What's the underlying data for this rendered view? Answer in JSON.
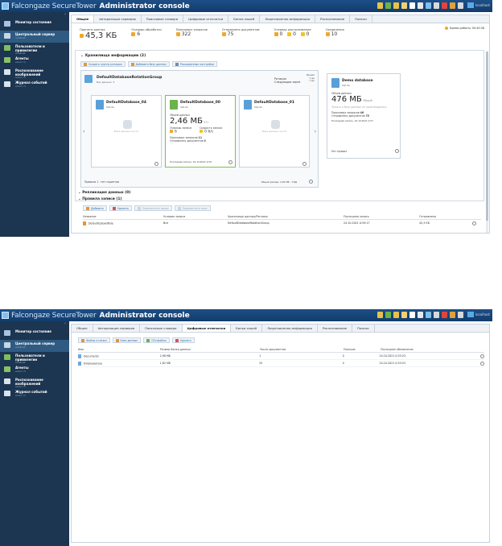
{
  "brand": "Falcongaze SecureTower",
  "title": "Administrator console",
  "host": "localhost",
  "sidebar": [
    {
      "label": "Монитор состояния",
      "sub": "",
      "color": "#aac4e0"
    },
    {
      "label": "Центральный сервер",
      "sub": "localhost",
      "color": "#c9d6e3"
    },
    {
      "label": "Пользователи и привилегии",
      "sub": "localhost",
      "color": "#7fbf5a"
    },
    {
      "label": "Агенты",
      "sub": "агент (?)",
      "color": "#8ac263"
    },
    {
      "label": "Распознавание изображений",
      "sub": "агент (?)",
      "color": "#d9e3ee"
    },
    {
      "label": "Журнал событий",
      "sub": "агент (?)",
      "color": "#d9e3ee"
    }
  ],
  "tabs1": [
    "Общее",
    "Авторизация серверов",
    "Поисковые словари",
    "Цифровые отпечатки",
    "Банки хэшей",
    "Лицензионная информация",
    "Распознавание",
    "Поиски"
  ],
  "tabs2": [
    "Общее",
    "Авторизация серверов",
    "Поисковые словари",
    "Цифровые отпечатки",
    "Банки хэшей",
    "Лицензионная информация",
    "Распознавание",
    "Поиски"
  ],
  "stats": {
    "received_label": "Принято данных",
    "received": "45,3 КБ",
    "q_proc_label": "Очередь обработки",
    "q_proc": "6",
    "search_req_label": "Поисковых запросов",
    "search_req": "322",
    "sent_docs_label": "Отправлено документов",
    "sent_docs": "75",
    "q_recog_label": "Очередь распознавания",
    "q_recog_a": "0",
    "q_recog_b": "0",
    "q_recog_c": "0",
    "conn_label": "Соединения",
    "conn": "10",
    "uptime": "Время работы: 00:49:38"
  },
  "storage": {
    "title": "Хранилища информации (2)",
    "btn_create_group": "Создать группу ротации",
    "btn_add_db": "Добавить базу данных",
    "btn_ext": "Расширенные настройки",
    "group_name": "DefaultDatabaseRotationGroup",
    "group_sub": "Баз данных: 3",
    "rotation_label": "Ротация",
    "next_label": "Следующая через",
    "rotation_time": "Время",
    "rotation_val1": "7 дн",
    "rotation_val2": "7 дн",
    "db1_name": "DefaultDatabase_04",
    "db1_type": "SQLite",
    "db1_empty": "База данных пуста",
    "db2_name": "DefaultDatabase_00",
    "db2_type": "SQLite",
    "db2_total_label": "Объем данных",
    "db2_total": "2,46 МБ",
    "db2_total_sub": "571",
    "db2_queue_label": "Очередь записи",
    "db2_queue": "6",
    "db2_speed_label": "Скорость записи",
    "db2_speed": "0 б/с",
    "db2_sreq_label": "Поисковых запросов",
    "db2_sreq": "11",
    "db2_sent_label": "Отправлено документов",
    "db2_sent": "0",
    "db2_last": "Последняя запись: 24.10.2021 0:59",
    "db3_name": "DefaultDatabase_01",
    "db3_type": "SQLite",
    "db3_empty": "База данных пуста",
    "rules_footer": "Правило 1 · нет скриптов",
    "total_footer": "Общий размер: 2,46 МБ · 3 БД",
    "demo_name": "Demo database",
    "demo_type": "SQLite",
    "demo_total_label": "Объем данных",
    "demo_total": "476 МБ",
    "demo_total_sub": "Общий",
    "demo_note": "Запись в базу данных не производилась",
    "demo_sreq_label": "Поисковых запросов",
    "demo_sreq": "46",
    "demo_sent_label": "Отправлено документов",
    "demo_sent": "75",
    "demo_last": "Последняя запись: 22.10.2021 2:07",
    "demo_rule": "Нет правил"
  },
  "replication": {
    "title": "Репликация данных (0)"
  },
  "rules": {
    "title": "Правила записи (1)",
    "btn_add": "Добавить",
    "btn_del": "Удалить",
    "btn_up": "Переместить вверх",
    "btn_down": "Переместить вниз",
    "headers": [
      "Название",
      "Условия записи",
      "Хранилище данных/Реплика",
      "Последняя запись",
      "Отправлено"
    ],
    "rows": [
      [
        "DefaultUploadRule",
        "Все",
        "DefaultDatabaseRotationGroup",
        "24.10.2021 0:59:17",
        "45,3 КБ"
      ]
    ]
  },
  "fp": {
    "btn_files": "Файлы и папки",
    "btn_db": "База данных",
    "btn_csv": "CSV-файлы",
    "btn_del": "Удалить",
    "headers": [
      "Имя",
      "Размер банка данных",
      "Число документов",
      "Поисков",
      "Последнее обновление"
    ],
    "rows": [
      [
        "Documents",
        "2,98 МБ",
        "1",
        "0",
        "24.10.2021 0:53:23"
      ],
      [
        "EmployeeGuo",
        "1,82 МБ",
        "25",
        "0",
        "24.10.2021 0:53:23"
      ]
    ]
  }
}
